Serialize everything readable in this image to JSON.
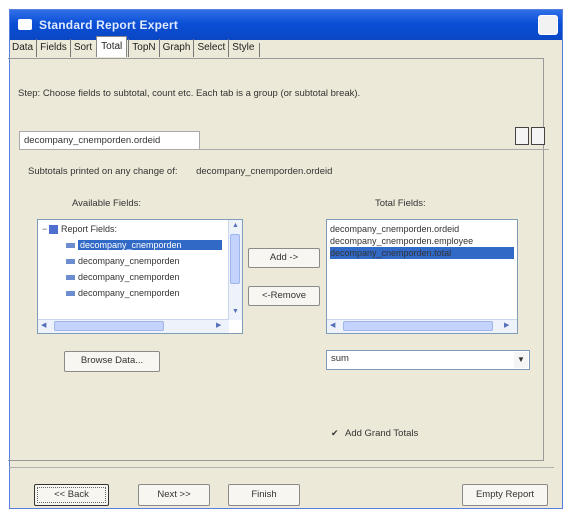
{
  "window": {
    "title": "Standard Report Expert"
  },
  "tabs": [
    {
      "label": "Data",
      "active": false
    },
    {
      "label": "Fields",
      "active": false
    },
    {
      "label": "Sort",
      "active": false
    },
    {
      "label": "Total",
      "active": true
    },
    {
      "label": "TopN",
      "active": false
    },
    {
      "label": "Graph",
      "active": false
    },
    {
      "label": "Select",
      "active": false
    },
    {
      "label": "Style",
      "active": false
    }
  ],
  "step_text": "Step:  Choose fields to subtotal, count etc.  Each tab is a group (or subtotal break).",
  "group_tab": {
    "label": "decompany_cnemporden.ordeid"
  },
  "subtotal_changed": {
    "label": "Subtotals printed on any change of:",
    "field": "decompany_cnemporden.ordeid"
  },
  "available_fields": {
    "label": "Available Fields:",
    "root": "Report Fields:",
    "items": [
      {
        "label": "decompany_cnemporden",
        "selected": true
      },
      {
        "label": "decompany_cnemporden",
        "selected": false
      },
      {
        "label": "decompany_cnemporden",
        "selected": false
      },
      {
        "label": "decompany_cnemporden",
        "selected": false
      }
    ]
  },
  "buttons": {
    "add": "Add ->",
    "remove": "<-Remove",
    "browse": "Browse Data...",
    "back": "<< Back",
    "next": "Next >>",
    "finish": "Finish",
    "empty_report": "Empty Report"
  },
  "total_fields": {
    "label": "Total Fields:",
    "items": [
      {
        "label": "decompany_cnemporden.ordeid",
        "selected": false
      },
      {
        "label": "decompany_cnemporden.employee",
        "selected": false
      },
      {
        "label": "decompany_cnemporden.total",
        "selected": true
      }
    ]
  },
  "summary_type": {
    "value": "sum"
  },
  "grand_totals": {
    "label": "Add Grand Totals",
    "checked": true
  },
  "colors": {
    "title_bar": "#0b4fd6",
    "selection": "#3169c6",
    "dialog_bg": "#ece9d8"
  }
}
